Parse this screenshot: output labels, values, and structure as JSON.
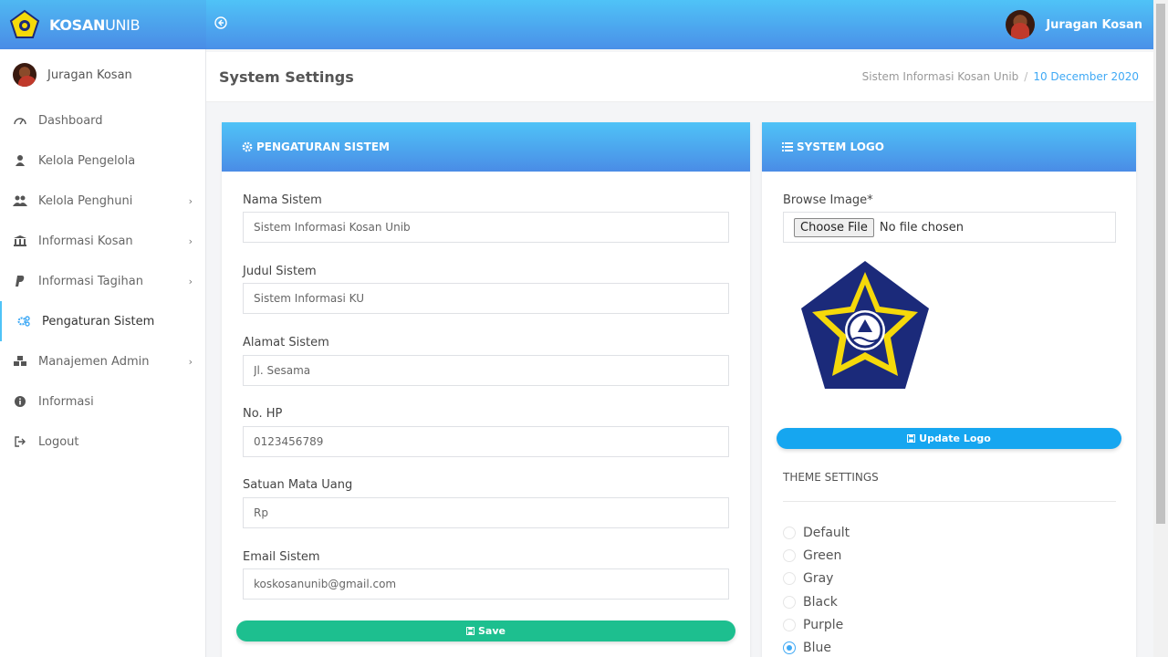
{
  "app": {
    "brand_bold": "KOSAN",
    "brand_light": "UNIB",
    "user_name": "Juragan Kosan"
  },
  "sidebar": {
    "user_name": "Juragan Kosan",
    "items": [
      {
        "label": "Dashboard",
        "icon": "dashboard-icon",
        "has_children": false,
        "active": false
      },
      {
        "label": "Kelola Pengelola",
        "icon": "user-icon",
        "has_children": false,
        "active": false
      },
      {
        "label": "Kelola Penghuni",
        "icon": "users-icon",
        "has_children": true,
        "active": false
      },
      {
        "label": "Informasi Kosan",
        "icon": "bank-icon",
        "has_children": true,
        "active": false
      },
      {
        "label": "Informasi Tagihan",
        "icon": "paypal-icon",
        "has_children": true,
        "active": false
      },
      {
        "label": "Pengaturan Sistem",
        "icon": "gears-icon",
        "has_children": false,
        "active": true
      },
      {
        "label": "Manajemen Admin",
        "icon": "cubes-icon",
        "has_children": true,
        "active": false
      },
      {
        "label": "Informasi",
        "icon": "info-icon",
        "has_children": false,
        "active": false
      },
      {
        "label": "Logout",
        "icon": "logout-icon",
        "has_children": false,
        "active": false
      }
    ]
  },
  "page": {
    "title": "System Settings",
    "breadcrumb_home": "Sistem Informasi Kosan Unib",
    "breadcrumb_sep": "/",
    "breadcrumb_current": "10 December 2020"
  },
  "settings_card": {
    "title": "PENGATURAN SISTEM",
    "fields": [
      {
        "label": "Nama Sistem",
        "value": "Sistem Informasi Kosan Unib"
      },
      {
        "label": "Judul Sistem",
        "value": "Sistem Informasi KU"
      },
      {
        "label": "Alamat Sistem",
        "value": "Jl. Sesama"
      },
      {
        "label": "No. HP",
        "value": "0123456789"
      },
      {
        "label": "Satuan Mata Uang",
        "value": "Rp"
      },
      {
        "label": "Email Sistem",
        "value": "koskosanunib@gmail.com"
      }
    ],
    "save_label": "Save"
  },
  "logo_card": {
    "title": "SYSTEM LOGO",
    "browse_label": "Browse Image*",
    "choose_file_label": "Choose File",
    "no_file_label": "No file chosen",
    "update_label": "Update Logo",
    "theme_title": "THEME SETTINGS",
    "themes": [
      {
        "label": "Default",
        "selected": false
      },
      {
        "label": "Green",
        "selected": false
      },
      {
        "label": "Gray",
        "selected": false
      },
      {
        "label": "Black",
        "selected": false
      },
      {
        "label": "Purple",
        "selected": false
      },
      {
        "label": "Blue",
        "selected": true
      }
    ]
  },
  "colors": {
    "header": "#4a90e8",
    "accent": "#3fa9f5",
    "save": "#1dbf8f",
    "update": "#16a6f0"
  }
}
